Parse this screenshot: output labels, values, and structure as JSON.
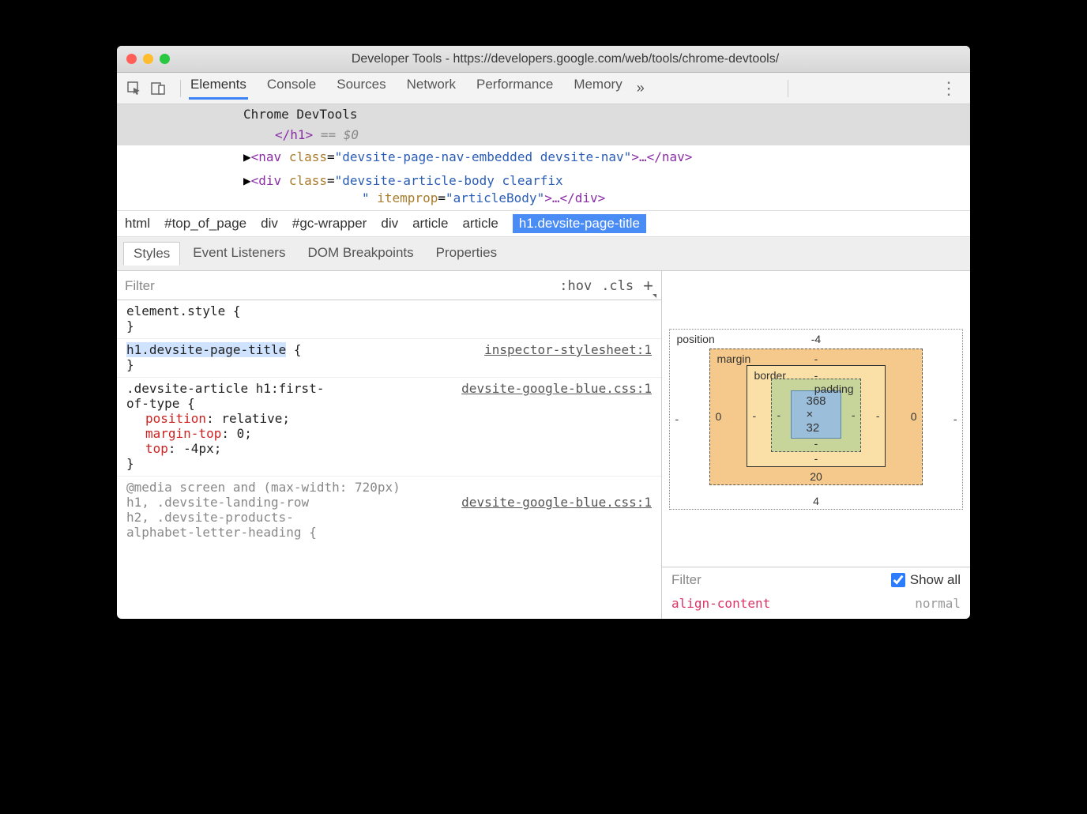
{
  "window": {
    "title": "Developer Tools - https://developers.google.com/web/tools/chrome-devtools/"
  },
  "toolbar": {
    "tabs": [
      "Elements",
      "Console",
      "Sources",
      "Network",
      "Performance",
      "Memory"
    ],
    "overflow": "»"
  },
  "dom": {
    "line1_text": "Chrome DevTools",
    "line2_close": "</h1>",
    "line2_eq": " == ",
    "line2_dollar": "$0",
    "nav_open": "<nav ",
    "nav_attr": "class",
    "nav_val": "\"devsite-page-nav-embedded devsite-nav\"",
    "nav_close": ">…</nav>",
    "div_open": "<div ",
    "div_attr1": "class",
    "div_val1": "\"devsite-article-body clearfix",
    "div_cont": "\" ",
    "div_attr2": "itemprop",
    "div_val2": "\"articleBody\"",
    "div_close": ">…</div>"
  },
  "breadcrumb": [
    "html",
    "#top_of_page",
    "div",
    "#gc-wrapper",
    "div",
    "article",
    "article",
    "h1.devsite-page-title"
  ],
  "subtabs": [
    "Styles",
    "Event Listeners",
    "DOM Breakpoints",
    "Properties"
  ],
  "filterbar": {
    "placeholder": "Filter",
    "hov": ":hov",
    "cls": ".cls",
    "plus": "+"
  },
  "rules": {
    "r0": {
      "sel1": "element.style {",
      "close": "}"
    },
    "r1": {
      "sel": "h1.devsite-page-title",
      "brace": " {",
      "src": "inspector-stylesheet:1",
      "close": "}"
    },
    "r2": {
      "sel1": ".devsite-article h1:first-",
      "sel2": "of-type {",
      "src": "devsite-google-blue.css:1",
      "p1n": "position",
      "p1v": ": relative;",
      "p2n": "margin-top",
      "p2v": ": 0;",
      "p3n": "top",
      "p3v": ": -4px;",
      "close": "}"
    },
    "r3": {
      "media": "@media screen and (max-width: 720px)",
      "src": "devsite-google-blue.css:1",
      "sel1": "h1, .devsite-landing-row",
      "sel2": "h2, .devsite-products-",
      "sel3": "alphabet-letter-heading {"
    }
  },
  "boxmodel": {
    "position": {
      "label": "position",
      "top": "-4",
      "right": "-",
      "bottom": "4",
      "left": "-"
    },
    "margin": {
      "label": "margin",
      "top": "-",
      "right": "0",
      "bottom": "20",
      "left": "0"
    },
    "border": {
      "label": "border",
      "top": "-",
      "right": "-",
      "bottom": "-",
      "left": "-"
    },
    "padding": {
      "label": "padding",
      "top": "-",
      "right": "-",
      "bottom": "-",
      "left": "-"
    },
    "content": "368 × 32"
  },
  "compfilter": {
    "placeholder": "Filter",
    "showall": "Show all"
  },
  "computed": {
    "name": "align-content",
    "value": "normal"
  }
}
